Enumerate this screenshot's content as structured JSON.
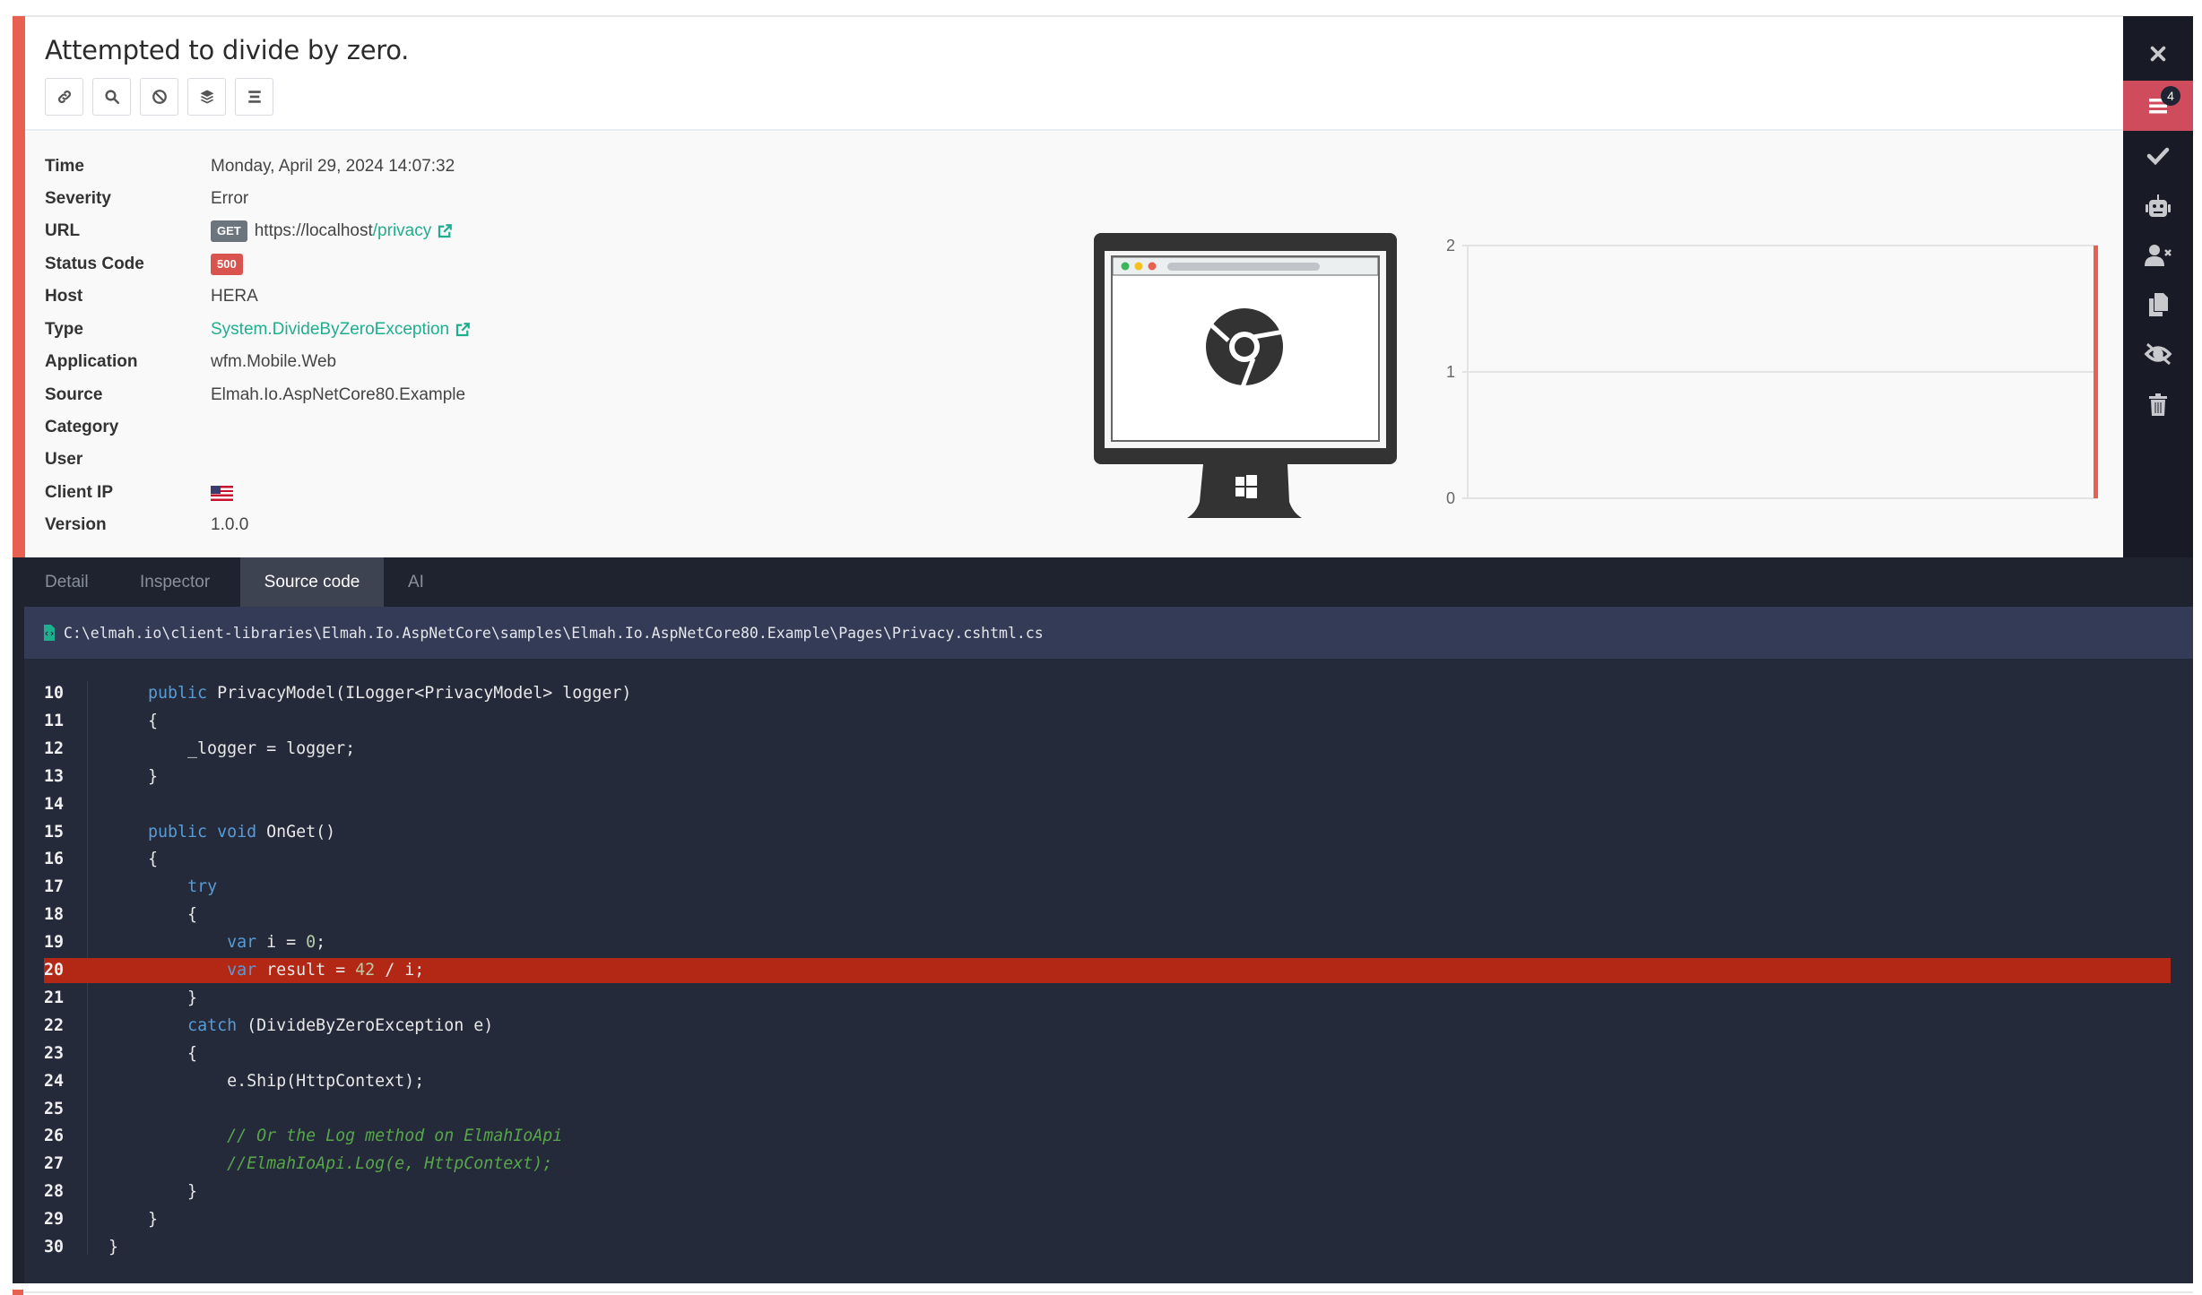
{
  "title": "Attempted to divide by zero.",
  "toolbar": [
    {
      "icon": "link-icon"
    },
    {
      "icon": "search-icon"
    },
    {
      "icon": "ban-icon"
    },
    {
      "icon": "layers-icon"
    },
    {
      "icon": "list-icon"
    }
  ],
  "details": {
    "time": {
      "label": "Time",
      "value": "Monday, April 29, 2024 14:07:32"
    },
    "severity": {
      "label": "Severity",
      "value": "Error"
    },
    "url": {
      "label": "URL",
      "method": "GET",
      "base": "https://localhost",
      "path": "/privacy"
    },
    "status": {
      "label": "Status Code",
      "value": "500"
    },
    "host": {
      "label": "Host",
      "value": "HERA"
    },
    "type": {
      "label": "Type",
      "value": "System.DivideByZeroException"
    },
    "application": {
      "label": "Application",
      "value": "wfm.Mobile.Web"
    },
    "source": {
      "label": "Source",
      "value": "Elmah.Io.AspNetCore80.Example"
    },
    "category": {
      "label": "Category",
      "value": ""
    },
    "user": {
      "label": "User",
      "value": ""
    },
    "client_ip": {
      "label": "Client IP",
      "flag": "us-flag"
    },
    "version": {
      "label": "Version",
      "value": "1.0.0"
    }
  },
  "colors": {
    "accent": "#e8604f",
    "link": "#1fae8e",
    "sidebar": "#181b26",
    "active": "#cf4c5c",
    "highlight": "#b32715"
  },
  "chart_data": {
    "type": "bar",
    "yticks": [
      "0",
      "1",
      "2"
    ],
    "ylim": [
      0,
      2
    ],
    "grid": true,
    "values_note_last_bar": 2
  },
  "sidebar": {
    "items": [
      {
        "icon": "close-icon"
      },
      {
        "icon": "list-icon",
        "active": true,
        "count": "4"
      },
      {
        "icon": "check-icon"
      },
      {
        "icon": "robot-icon"
      },
      {
        "icon": "user-x-icon"
      },
      {
        "icon": "copy-icon"
      },
      {
        "icon": "eye-slash-icon"
      },
      {
        "icon": "trash-icon"
      }
    ]
  },
  "tabs": [
    {
      "label": "Detail"
    },
    {
      "label": "Inspector"
    },
    {
      "label": "Source code",
      "active": true
    },
    {
      "label": "AI"
    }
  ],
  "file_path": "C:\\elmah.io\\client-libraries\\Elmah.Io.AspNetCore\\samples\\Elmah.Io.AspNetCore80.Example\\Pages\\Privacy.cshtml.cs",
  "code": {
    "highlight_line": 20,
    "lines": [
      {
        "n": "10",
        "t": [
          [
            "",
            "    "
          ],
          [
            "kw",
            "public"
          ],
          [
            "",
            " PrivacyModel(ILogger<PrivacyModel> logger)"
          ]
        ]
      },
      {
        "n": "11",
        "t": [
          [
            "",
            "    {"
          ]
        ]
      },
      {
        "n": "12",
        "t": [
          [
            "",
            "        _logger = logger;"
          ]
        ]
      },
      {
        "n": "13",
        "t": [
          [
            "",
            "    }"
          ]
        ]
      },
      {
        "n": "14",
        "t": []
      },
      {
        "n": "15",
        "t": [
          [
            "",
            "    "
          ],
          [
            "kw",
            "public"
          ],
          [
            "",
            " "
          ],
          [
            "kw",
            "void"
          ],
          [
            "",
            " OnGet()"
          ]
        ]
      },
      {
        "n": "16",
        "t": [
          [
            "",
            "    {"
          ]
        ]
      },
      {
        "n": "17",
        "t": [
          [
            "",
            "        "
          ],
          [
            "kw",
            "try"
          ]
        ]
      },
      {
        "n": "18",
        "t": [
          [
            "",
            "        {"
          ]
        ]
      },
      {
        "n": "19",
        "t": [
          [
            "",
            "            "
          ],
          [
            "kw",
            "var"
          ],
          [
            "",
            " i = "
          ],
          [
            "num",
            "0"
          ],
          [
            "",
            ";"
          ]
        ]
      },
      {
        "n": "20",
        "t": [
          [
            "",
            "            "
          ],
          [
            "kw",
            "var"
          ],
          [
            "",
            " result = "
          ],
          [
            "num",
            "42"
          ],
          [
            "",
            " / i;"
          ]
        ]
      },
      {
        "n": "21",
        "t": [
          [
            "",
            "        }"
          ]
        ]
      },
      {
        "n": "22",
        "t": [
          [
            "",
            "        "
          ],
          [
            "kw",
            "catch"
          ],
          [
            "",
            " (DivideByZeroException e)"
          ]
        ]
      },
      {
        "n": "23",
        "t": [
          [
            "",
            "        {"
          ]
        ]
      },
      {
        "n": "24",
        "t": [
          [
            "",
            "            e.Ship(HttpContext);"
          ]
        ]
      },
      {
        "n": "25",
        "t": []
      },
      {
        "n": "26",
        "t": [
          [
            "",
            "            "
          ],
          [
            "cm",
            "// Or the Log method on ElmahIoApi"
          ]
        ]
      },
      {
        "n": "27",
        "t": [
          [
            "",
            "            "
          ],
          [
            "cm",
            "//ElmahIoApi.Log(e, HttpContext);"
          ]
        ]
      },
      {
        "n": "28",
        "t": [
          [
            "",
            "        }"
          ]
        ]
      },
      {
        "n": "29",
        "t": [
          [
            "",
            "    }"
          ]
        ]
      },
      {
        "n": "30",
        "t": [
          [
            "",
            "}"
          ]
        ]
      }
    ]
  }
}
